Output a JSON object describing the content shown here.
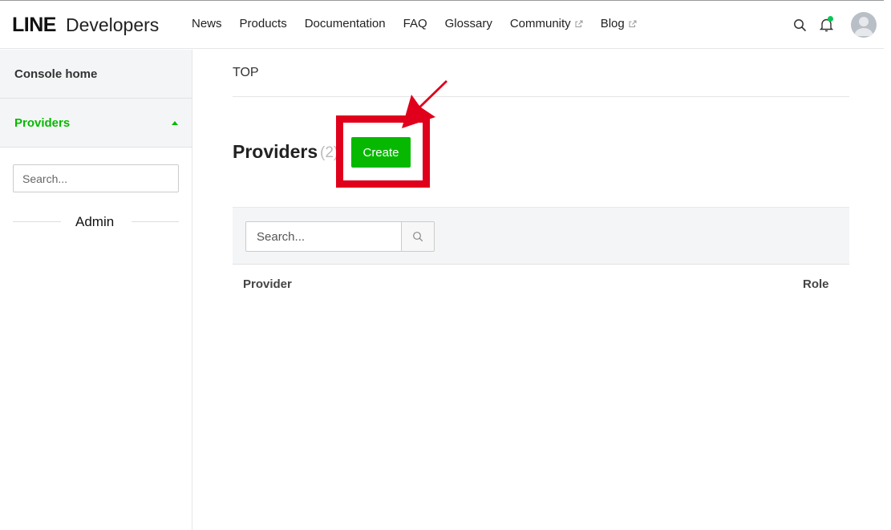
{
  "header": {
    "logo_line": "LINE",
    "logo_dev": "Developers",
    "nav": [
      {
        "label": "News",
        "external": false
      },
      {
        "label": "Products",
        "external": false
      },
      {
        "label": "Documentation",
        "external": false
      },
      {
        "label": "FAQ",
        "external": false
      },
      {
        "label": "Glossary",
        "external": false
      },
      {
        "label": "Community",
        "external": true
      },
      {
        "label": "Blog",
        "external": true
      }
    ],
    "icons": [
      "search-icon",
      "bell-icon",
      "avatar"
    ]
  },
  "sidebar": {
    "items": [
      {
        "label": "Console home"
      },
      {
        "label": "Providers"
      }
    ],
    "search_placeholder": "Search...",
    "section_label": "Admin"
  },
  "main": {
    "breadcrumb": "TOP",
    "title": "Providers",
    "count": "(2)",
    "create_label": "Create",
    "search_placeholder": "Search...",
    "columns": {
      "provider": "Provider",
      "role": "Role"
    }
  },
  "colors": {
    "accent": "#06b900",
    "highlight": "#e0001b"
  }
}
